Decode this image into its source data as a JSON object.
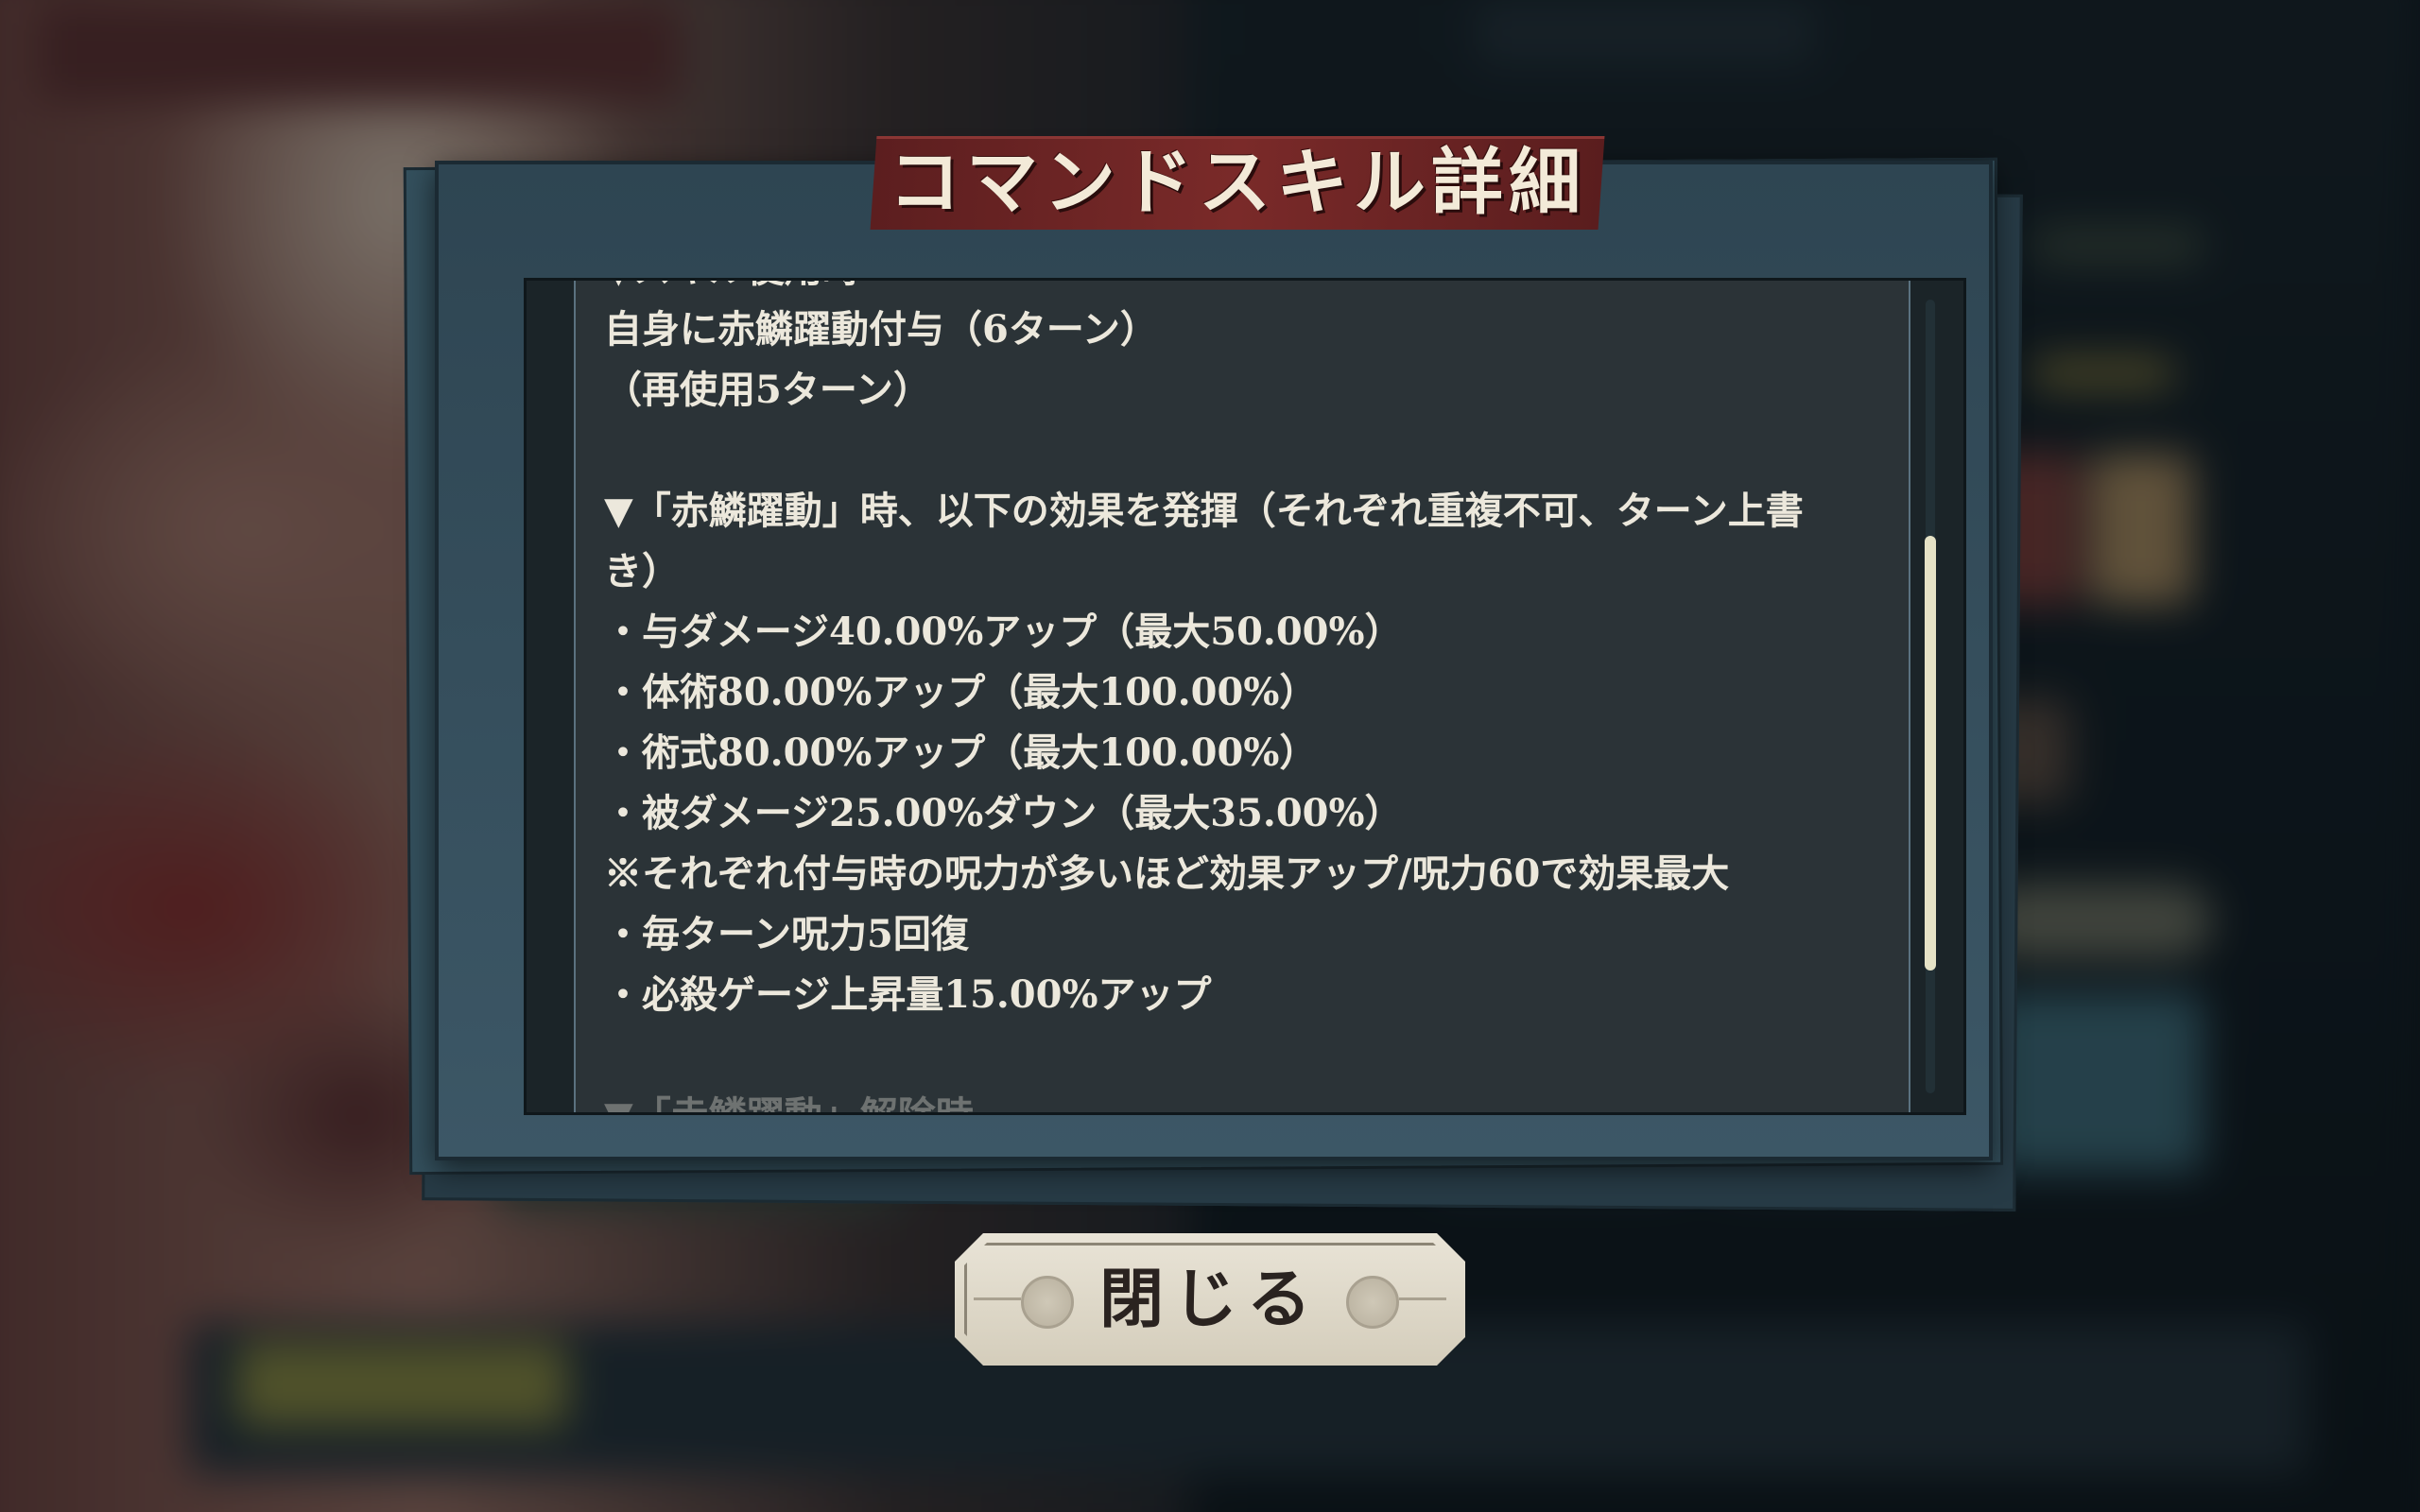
{
  "dialog": {
    "title": "コマンドスキル詳細",
    "lines": [
      "▼スキル使用時",
      "自身に赤鱗躍動付与（6ターン）",
      "（再使用5ターン）",
      "",
      "▼「赤鱗躍動」時、以下の効果を発揮（それぞれ重複不可、ターン上書",
      "き）",
      "・与ダメージ40.00%アップ（最大50.00%）",
      "・体術80.00%アップ（最大100.00%）",
      "・術式80.00%アップ（最大100.00%）",
      "・被ダメージ25.00%ダウン（最大35.00%）",
      "※それぞれ付与時の呪力が多いほど効果アップ/呪力60で効果最大",
      "・毎ターン呪力5回復",
      "・必殺ゲージ上昇量15.00%アップ",
      "",
      "▼「赤鱗躍動」解除時"
    ],
    "scroll_position": 0.35
  },
  "close_button": {
    "label": "閉じる"
  },
  "colors": {
    "title_plate": "#7a2a29",
    "frame": "#3c5766",
    "content_bg": "#2b3337",
    "text": "#ece8dc",
    "scroll_thumb": "#e6e2c6",
    "button_bg": "#e9e4d7"
  }
}
